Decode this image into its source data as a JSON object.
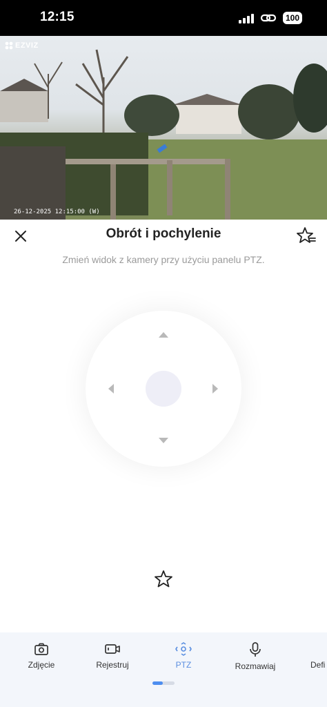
{
  "status_bar": {
    "time": "12:15",
    "battery": "100"
  },
  "camera": {
    "logo": "EZVIZ",
    "timestamp": "26-12-2025 12:15:00 (W)"
  },
  "sheet": {
    "title": "Obrót i pochylenie",
    "subtitle": "Zmień widok z kamery przy użyciu panelu PTZ."
  },
  "toolbar": {
    "items": [
      {
        "label": "Zdjęcie",
        "icon": "camera-icon"
      },
      {
        "label": "Rejestruj",
        "icon": "video-icon"
      },
      {
        "label": "PTZ",
        "icon": "ptz-icon",
        "active": true
      },
      {
        "label": "Rozmawiaj",
        "icon": "microphone-icon"
      },
      {
        "label": "Defi",
        "icon": "definition-icon"
      }
    ],
    "page_indicator": {
      "current": 1,
      "total": 2
    }
  },
  "colors": {
    "accent": "#4d8ef0",
    "toolbar_bg": "#f3f6fb",
    "muted_text": "#9a9a9a"
  }
}
